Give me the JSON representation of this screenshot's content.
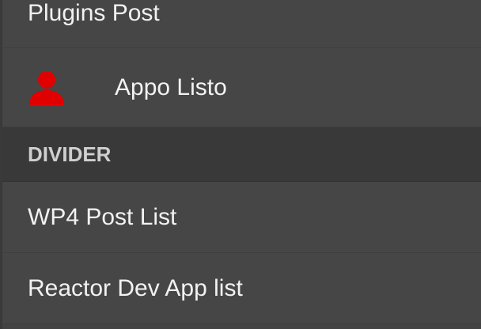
{
  "menu": {
    "items": [
      {
        "label": "Plugins Post"
      },
      {
        "label": "Appo Listo",
        "icon": "user-icon",
        "icon_color": "#e00000"
      },
      {
        "label": "DIVIDER",
        "type": "divider"
      },
      {
        "label": "WP4 Post List"
      },
      {
        "label": "Reactor Dev App list"
      }
    ]
  },
  "colors": {
    "background": "#464646",
    "divider_background": "#393939",
    "text": "#f2f2f2",
    "divider_text": "#cfcfcf",
    "accent_icon": "#e00000"
  }
}
